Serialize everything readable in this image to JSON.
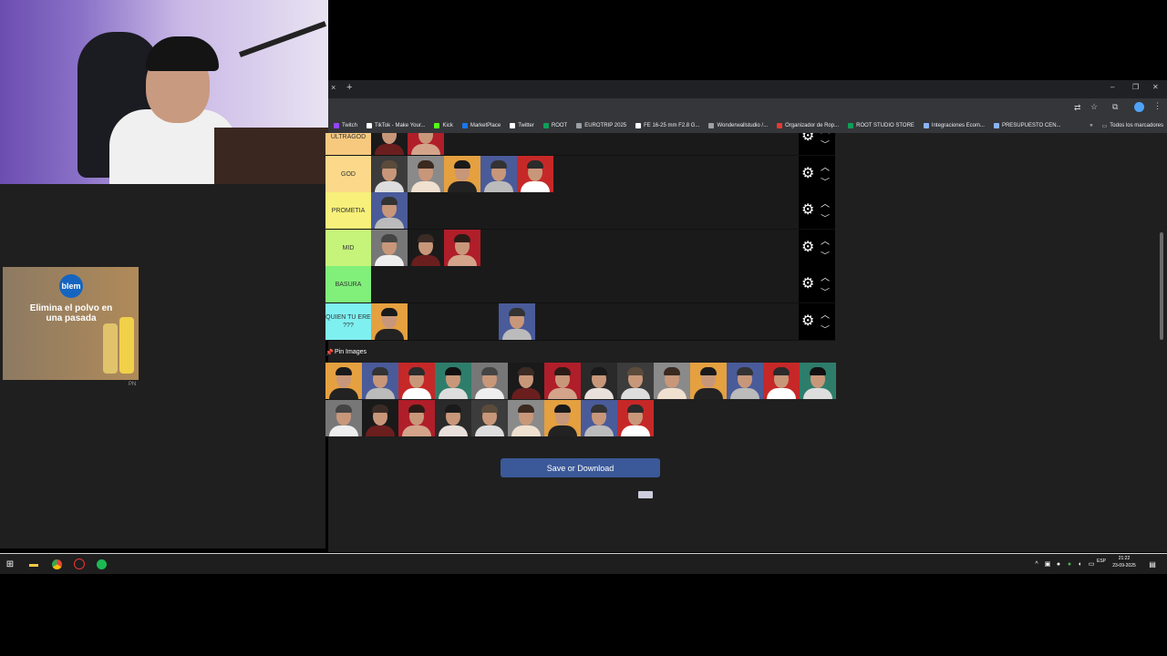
{
  "browser": {
    "new_tab": "+",
    "close_tab": "×",
    "window_controls": [
      "–",
      "❐",
      "✕"
    ],
    "bookmarks": [
      {
        "label": "Twitch",
        "color": "#9146ff"
      },
      {
        "label": "TikTok - Make Your...",
        "color": "#ffffff"
      },
      {
        "label": "Kick",
        "color": "#53fc18"
      },
      {
        "label": "MarketPlace",
        "color": "#1877f2"
      },
      {
        "label": "Twitter",
        "color": "#ffffff"
      },
      {
        "label": "ROOT",
        "color": "#0f9d58"
      },
      {
        "label": "EUROTRIP 2025",
        "color": "#9aa0a6"
      },
      {
        "label": "FE 16-25 mm F2.8 G...",
        "color": "#ffffff"
      },
      {
        "label": "Wonderwallstudio /...",
        "color": "#9aa0a6"
      },
      {
        "label": "Organizador de Rop...",
        "color": "#e53935"
      },
      {
        "label": "ROOT STUDIO STORE",
        "color": "#0f9d58"
      },
      {
        "label": "Integraciones Ecom...",
        "color": "#8ab4f8"
      },
      {
        "label": "PRESUPUESTO CEN...",
        "color": "#8ab4f8"
      }
    ],
    "bookmarks_more": "»",
    "all_bookmarks": "Todos los marcadores"
  },
  "tiers": [
    {
      "label": "ULTRAGOD",
      "color": "#f7c97e",
      "tiles": 2
    },
    {
      "label": "GOD",
      "color": "#fcd98a",
      "tiles": 5
    },
    {
      "label": "PROMETIA",
      "color": "#f7f07a",
      "tiles": 1
    },
    {
      "label": "MID",
      "color": "#c6f47a",
      "tiles": 3
    },
    {
      "label": "BASURA",
      "color": "#80f07a",
      "tiles": 0
    },
    {
      "label": "QUIEN TU ERE ???",
      "color": "#7ff0f0",
      "tiles": 2
    }
  ],
  "pin_images_label": "Pin Images",
  "pool_count": 23,
  "save_button": "Save or Download",
  "ad": {
    "headline": "Elimina el polvo en una pasada",
    "brand": "blem",
    "tag": "PN"
  },
  "system": {
    "language": "ESP",
    "time": "21:22",
    "date": "23-09-2025"
  }
}
